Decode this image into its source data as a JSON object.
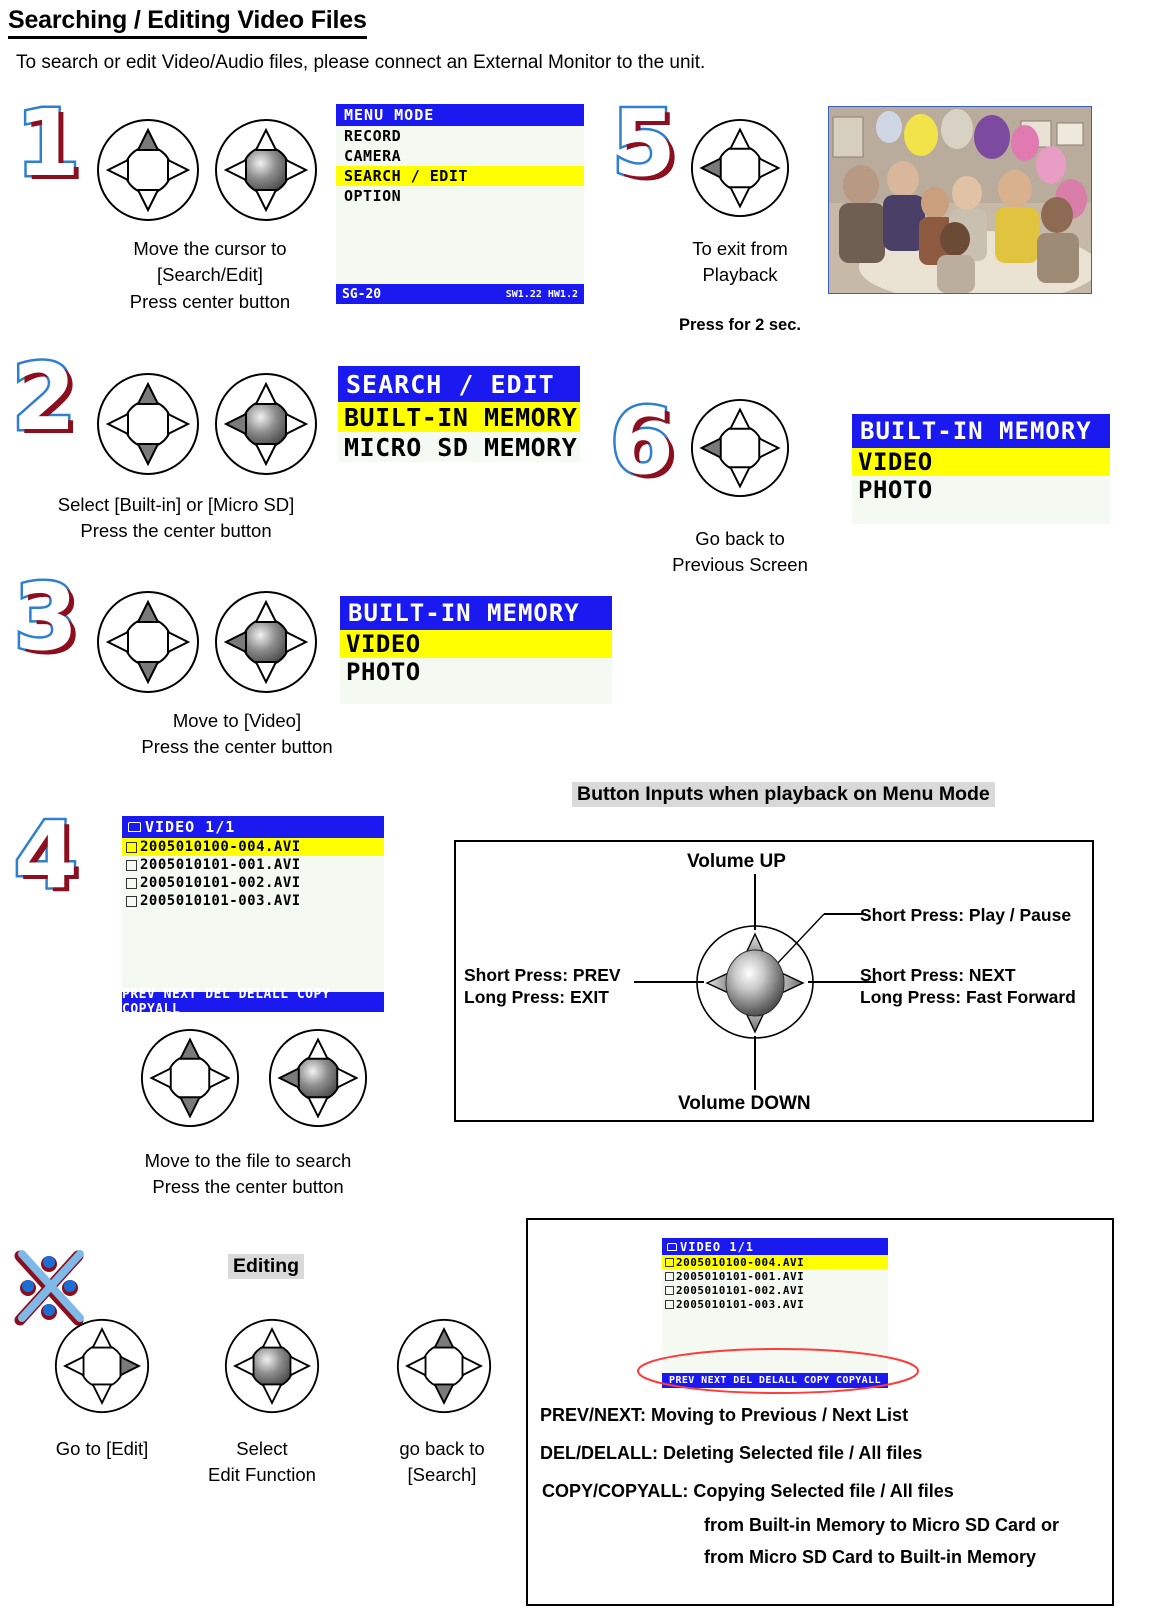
{
  "header": {
    "title": "Searching / Editing Video Files",
    "intro": "To search or edit Video/Audio files, please connect an External Monitor to the unit."
  },
  "steps": {
    "one": {
      "number": "1",
      "caption_lines": [
        "Move the cursor to",
        "[Search/Edit]",
        "Press center button"
      ]
    },
    "two": {
      "number": "2",
      "caption_lines": [
        "Select [Built-in] or [Micro SD]",
        "Press the center button"
      ]
    },
    "three": {
      "number": "3",
      "caption_lines": [
        "Move to [Video]",
        "Press the center button"
      ]
    },
    "four": {
      "number": "4",
      "caption_lines": [
        "Move to the file to search",
        "Press the center button"
      ]
    },
    "five": {
      "number": "5",
      "caption_lines": [
        "To exit from",
        "Playback"
      ],
      "bold_note": "Press for 2 sec."
    },
    "six": {
      "number": "6",
      "caption_lines": [
        "Go back to",
        "Previous Screen"
      ]
    }
  },
  "screens": {
    "menu_mode": {
      "title": "MENU MODE",
      "items": [
        "RECORD",
        "CAMERA",
        "SEARCH / EDIT",
        "OPTION"
      ],
      "selected_index": 2,
      "foot_left": "SG-20",
      "foot_right": "SW1.22 HW1.2"
    },
    "search_edit": {
      "title": "SEARCH / EDIT",
      "items": [
        "BUILT-IN MEMORY",
        "MICRO SD MEMORY"
      ],
      "selected_index": 0
    },
    "built_in_memory": {
      "title": "BUILT-IN MEMORY",
      "items": [
        "VIDEO",
        "PHOTO"
      ],
      "selected_index": 0
    },
    "built_in_memory_2": {
      "title": "BUILT-IN MEMORY",
      "items": [
        "VIDEO",
        "PHOTO"
      ],
      "selected_index": 0
    },
    "video_list": {
      "title": "VIDEO  1/1",
      "files": [
        "2005010100-004.AVI",
        "2005010101-001.AVI",
        "2005010101-002.AVI",
        "2005010101-003.AVI"
      ],
      "selected_index": 0,
      "toolbar": "PREV NEXT DEL DELALL COPY COPYALL"
    },
    "video_list_2": {
      "title": "VIDEO  1/1",
      "files": [
        "2005010100-004.AVI",
        "2005010101-001.AVI",
        "2005010101-002.AVI",
        "2005010101-003.AVI"
      ],
      "selected_index": 0,
      "toolbar": "PREV NEXT DEL DELALL COPY COPYALL"
    }
  },
  "editing": {
    "heading": "Editing",
    "captions": [
      [
        "Go to [Edit]"
      ],
      [
        "Select",
        "Edit Function"
      ],
      [
        "go back to",
        "[Search]"
      ]
    ]
  },
  "button_inputs": {
    "heading": "Button Inputs when playback on Menu Mode",
    "top_label": "Volume UP",
    "bottom_label": "Volume DOWN",
    "left_label_1": "Short Press: PREV",
    "left_label_2": "Long Press: EXIT",
    "right_label_1": "Short Press: NEXT",
    "right_label_2": "Long Press: Fast Forward",
    "center_label": "Short Press: Play / Pause"
  },
  "toolbar_info": {
    "line1": "PREV/NEXT: Moving to Previous / Next List",
    "line2": "DEL/DELALL: Deleting Selected file / All files",
    "line3": "COPY/COPYALL: Copying Selected file / All files",
    "line4": "from Built-in Memory to Micro SD Card or",
    "line5": "from Micro SD Card to Built-in Memory"
  },
  "colors": {
    "lcd_blue": "#1a1af0",
    "lcd_yellow": "#ffff00",
    "lcd_bg": "#f4f9f2",
    "highlight_gray": "#d9d9d9",
    "number_blue": "#2f7fd0",
    "number_red": "#8b0f1e"
  }
}
